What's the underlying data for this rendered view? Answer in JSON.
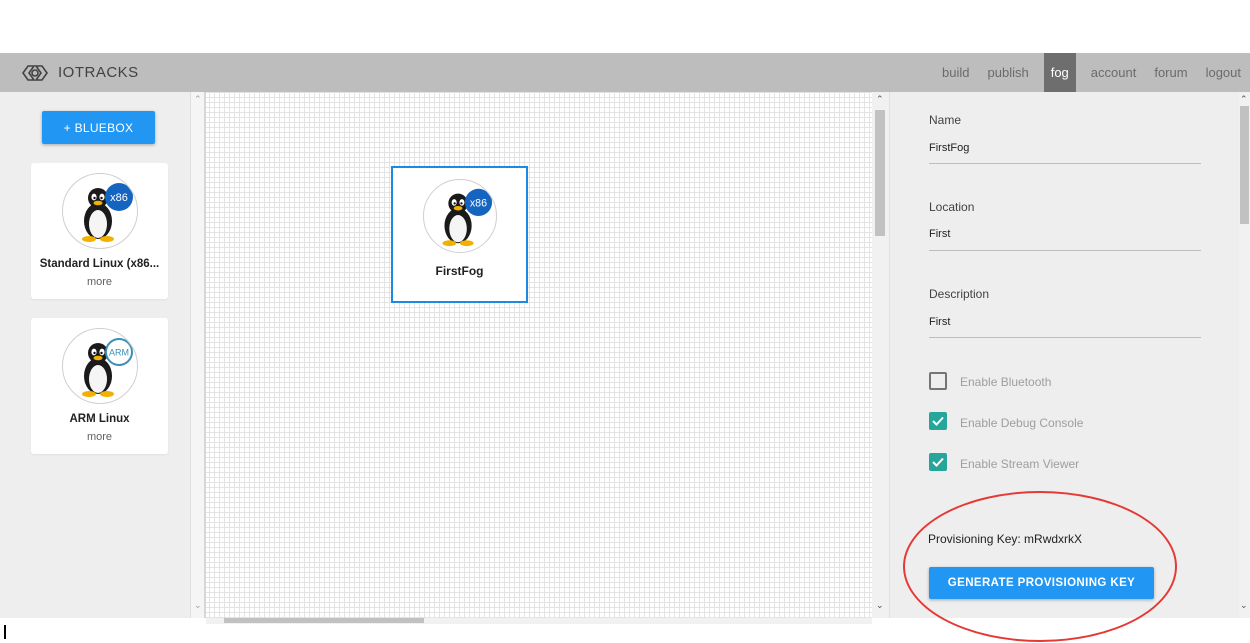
{
  "header": {
    "app_name": "IOTRACKS",
    "nav": [
      {
        "label": "build"
      },
      {
        "label": "publish"
      },
      {
        "label": "fog",
        "active": true
      },
      {
        "label": "account"
      },
      {
        "label": "forum"
      },
      {
        "label": "logout"
      }
    ]
  },
  "palette": {
    "add_button": "+ BLUEBOX",
    "cards": [
      {
        "title": "Standard Linux (x86...",
        "more": "more",
        "badge": "x86",
        "icon": "linux-penguin-icon"
      },
      {
        "title": "ARM Linux",
        "more": "more",
        "badge": "ARM",
        "icon": "linux-penguin-icon"
      }
    ]
  },
  "canvas": {
    "node": {
      "title": "FirstFog",
      "badge": "x86",
      "icon": "linux-penguin-icon"
    }
  },
  "properties": {
    "fields": [
      {
        "label": "Name",
        "value": "FirstFog"
      },
      {
        "label": "Location",
        "value": "First"
      },
      {
        "label": "Description",
        "value": "First"
      }
    ],
    "checkboxes": [
      {
        "label": "Enable Bluetooth",
        "checked": false
      },
      {
        "label": "Enable Debug Console",
        "checked": true
      },
      {
        "label": "Enable Stream Viewer",
        "checked": true
      }
    ],
    "provisioning_key_text": "Provisioning Key: mRwdxrkX",
    "generate_button": "GENERATE PROVISIONING KEY"
  },
  "colors": {
    "accent": "#2196f3",
    "header_bg": "#bdbdbd",
    "checkbox_checked": "#26a69a",
    "annotation": "#e53935",
    "node_border": "#1e88e5"
  }
}
